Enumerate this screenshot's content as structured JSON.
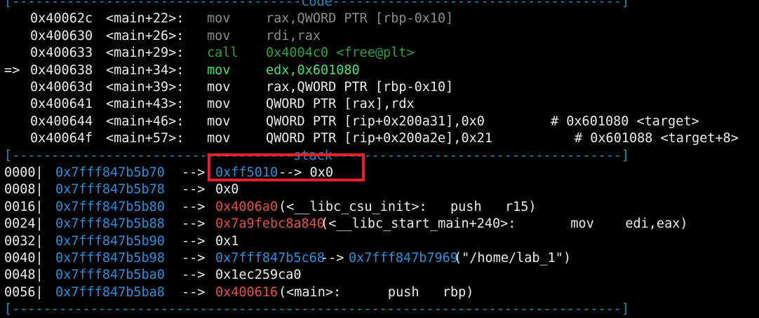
{
  "code_header": "[-------------------------------------code-------------------------------------]",
  "stack_header": "[------------------------------------stack-------------------------------------]",
  "bottom_header": "[------------------------------------------------------------------------------]",
  "code": [
    {
      "marker": "  ",
      "addr": "0x40062c",
      "sym": "<main+22>:",
      "op": "mov",
      "args": "rax,QWORD PTR [rbp-0x10]",
      "comment": "",
      "style": "dim"
    },
    {
      "marker": "  ",
      "addr": "0x400630",
      "sym": "<main+26>:",
      "op": "mov",
      "args": "rdi,rax",
      "comment": "",
      "style": "dim"
    },
    {
      "marker": "  ",
      "addr": "0x400633",
      "sym": "<main+29>:",
      "op": "call",
      "args": "0x4004c0 <free@plt>",
      "comment": "",
      "style": "call"
    },
    {
      "marker": "=>",
      "addr": "0x400638",
      "sym": "<main+34>:",
      "op": "mov",
      "args": "edx,0x601080",
      "comment": "",
      "style": "current"
    },
    {
      "marker": "  ",
      "addr": "0x40063d",
      "sym": "<main+39>:",
      "op": "mov",
      "args": "rax,QWORD PTR [rbp-0x10]",
      "comment": "",
      "style": "normal"
    },
    {
      "marker": "  ",
      "addr": "0x400641",
      "sym": "<main+43>:",
      "op": "mov",
      "args": "QWORD PTR [rax],rdx",
      "comment": "",
      "style": "normal"
    },
    {
      "marker": "  ",
      "addr": "0x400644",
      "sym": "<main+46>:",
      "op": "mov",
      "args": "QWORD PTR [rip+0x200a31],0x0",
      "comment": "# 0x601080 <target>",
      "style": "normal"
    },
    {
      "marker": "  ",
      "addr": "0x40064f",
      "sym": "<main+57>:",
      "op": "mov",
      "args": "QWORD PTR [rip+0x200a2e],0x21",
      "comment": "# 0x601088 <target+8>",
      "style": "normal"
    }
  ],
  "stack": [
    {
      "off": "0000|",
      "addr": "0x7fff847b5b70",
      "arrow": "-->",
      "val": "0xff5010",
      "val_color": "blue",
      "rest": "--> 0x0",
      "rest_color": "white"
    },
    {
      "off": "0008|",
      "addr": "0x7fff847b5b78",
      "arrow": "-->",
      "val": "0x0",
      "val_color": "white",
      "rest": "",
      "rest_color": "white"
    },
    {
      "off": "0016|",
      "addr": "0x7fff847b5b80",
      "arrow": "-->",
      "val": "0x4006a0",
      "val_color": "red",
      "rest": "(<__libc_csu_init>:   push   r15)",
      "rest_color": "white"
    },
    {
      "off": "0024|",
      "addr": "0x7fff847b5b88",
      "arrow": "-->",
      "val": "0x7a9febc8a840",
      "val_color": "red",
      "rest": "(<__libc_start_main+240>:       mov    edi,eax)",
      "rest_color": "white"
    },
    {
      "off": "0032|",
      "addr": "0x7fff847b5b90",
      "arrow": "-->",
      "val": "0x1",
      "val_color": "white",
      "rest": "",
      "rest_color": "white"
    },
    {
      "off": "0040|",
      "addr": "0x7fff847b5b98",
      "arrow": "-->",
      "val": "0x7fff847b5c68",
      "val_color": "blue",
      "rest2_addr": "0x7fff847b7969",
      "rest": "(\"/home/lab_1\")",
      "rest_color": "white"
    },
    {
      "off": "0048|",
      "addr": "0x7fff847b5ba0",
      "arrow": "-->",
      "val": "0x1ec259ca0",
      "val_color": "white",
      "rest": "",
      "rest_color": "white"
    },
    {
      "off": "0056|",
      "addr": "0x7fff847b5ba8",
      "arrow": "-->",
      "val": "0x400616",
      "val_color": "red",
      "rest": "(<main>:      push   rbp)",
      "rest_color": "white"
    }
  ],
  "colors": {
    "background": "#000000",
    "separator": "#1e8fbf",
    "highlight_box": "#e8202a"
  }
}
